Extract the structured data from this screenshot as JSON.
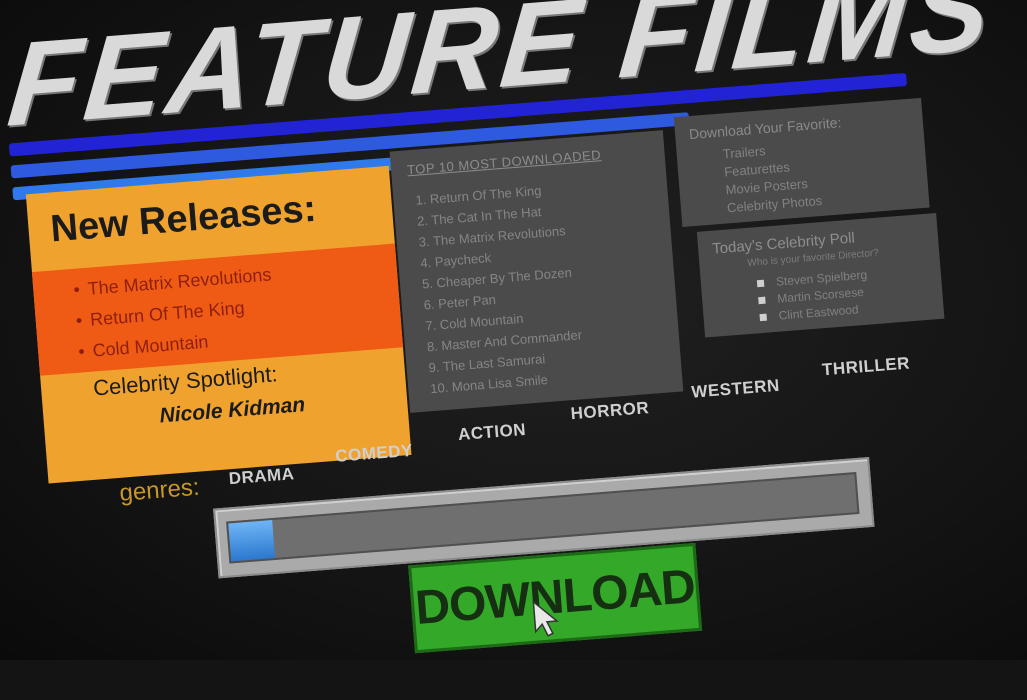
{
  "header": {
    "title": "FEATURE FILMS"
  },
  "new_releases": {
    "title": "New Releases:",
    "items": [
      "The Matrix Revolutions",
      "Return Of The King",
      "Cold Mountain"
    ],
    "spotlight_label": "Celebrity Spotlight:",
    "spotlight_name": "Nicole Kidman"
  },
  "top10": {
    "heading": "TOP 10 MOST DOWNLOADED",
    "items": [
      "1. Return Of The King",
      "2. The Cat In The Hat",
      "3. The Matrix Revolutions",
      "4. Paycheck",
      "5. Cheaper By The Dozen",
      "6. Peter Pan",
      "7. Cold Mountain",
      "8. Master And Commander",
      "9. The Last Samurai",
      "10. Mona Lisa Smile"
    ]
  },
  "download_favorites": {
    "heading": "Download Your Favorite:",
    "items": [
      "Trailers",
      "Featurettes",
      "Movie Posters",
      "Celebrity Photos"
    ]
  },
  "poll": {
    "heading": "Today's Celebrity Poll",
    "subheading": "Who is your favorite Director?",
    "options": [
      "Steven Spielberg",
      "Martin Scorsese",
      "Clint Eastwood"
    ]
  },
  "genres": {
    "label": "genres:",
    "items": [
      "DRAMA",
      "COMEDY",
      "ACTION",
      "HORROR",
      "WESTERN",
      "THRILLER"
    ]
  },
  "download": {
    "progress_fraction": 0.07,
    "button_label": "DOWNLOAD"
  },
  "colors": {
    "stripe1": "#2323d6",
    "stripe2": "#2e5ae0",
    "stripe3": "#2f79ea",
    "new_releases_bg": "#efa32e",
    "new_releases_band": "#ef5a14",
    "panel_bg": "#4b4b4b",
    "button_green": "#34a828"
  }
}
